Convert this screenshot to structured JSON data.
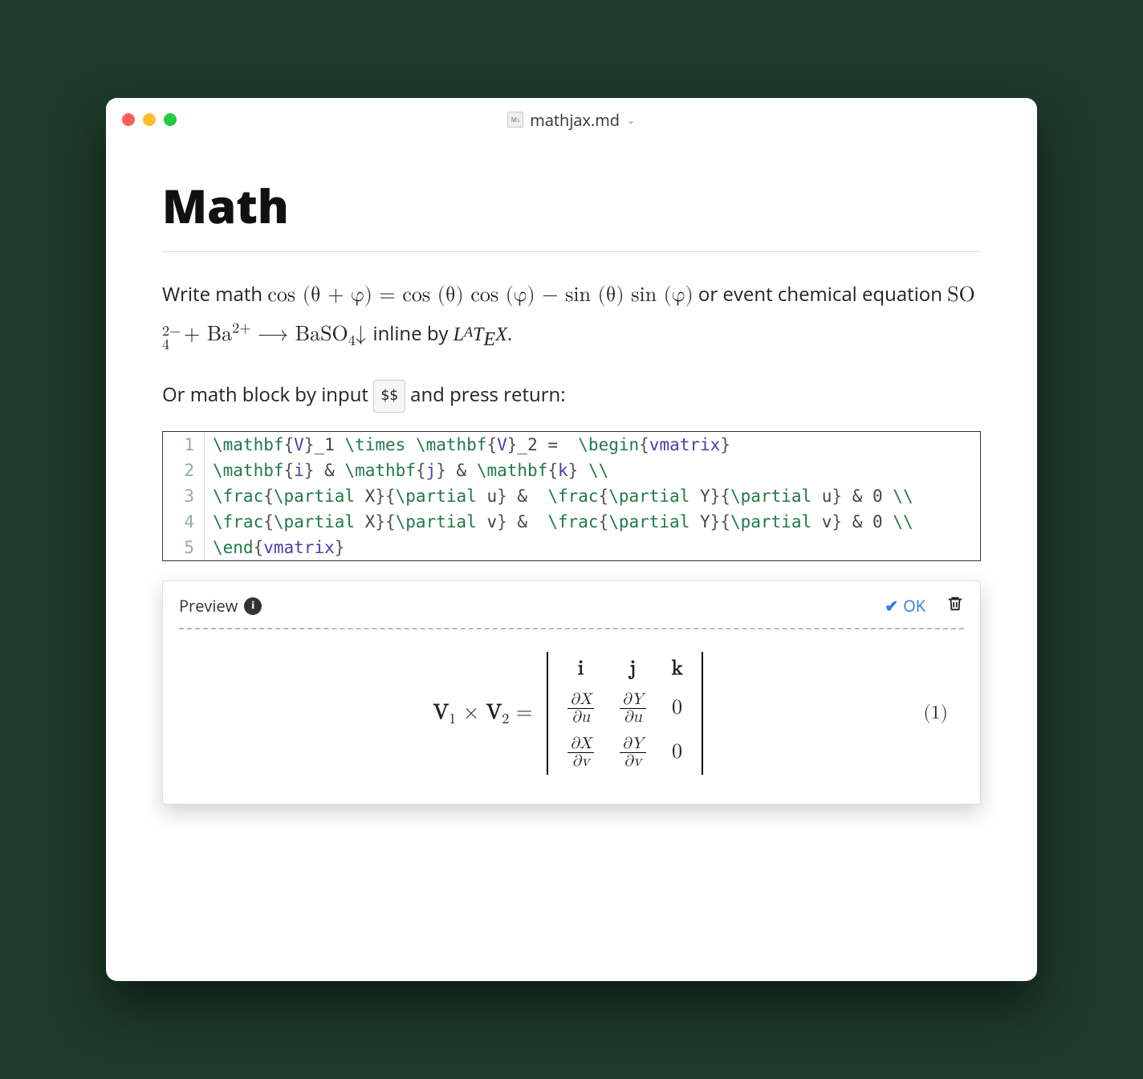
{
  "titlebar": {
    "filename": "mathjax.md"
  },
  "heading": "Math",
  "para1": {
    "pre": "Write math ",
    "inline_math": "cos (θ + φ) = cos (θ) cos (φ) − sin (θ) sin (φ)",
    "mid": "  or event chemical equation ",
    "chem_pre": "SO",
    "chem_so4_sup": "2−",
    "chem_so4_sub": "4",
    "chem_plus": " + Ba",
    "chem_ba_sup": "2+",
    "chem_arrow": " ⟶ BaSO",
    "chem_baso4_sub": "4",
    "chem_down": "↓",
    "post": "  inline by ",
    "latex_brand": "LATEX",
    "end": "."
  },
  "para2": {
    "pre": "Or math block by input ",
    "kbd": "$$",
    "post": " and press return:"
  },
  "code": {
    "line_numbers": [
      "1",
      "2",
      "3",
      "4",
      "5"
    ],
    "lines": [
      [
        {
          "t": "cmd",
          "v": "\\mathbf"
        },
        {
          "t": "brace",
          "v": "{"
        },
        {
          "t": "arg",
          "v": "V"
        },
        {
          "t": "brace",
          "v": "}"
        },
        {
          "t": "op",
          "v": "_1 "
        },
        {
          "t": "cmd",
          "v": "\\times "
        },
        {
          "t": "cmd",
          "v": "\\mathbf"
        },
        {
          "t": "brace",
          "v": "{"
        },
        {
          "t": "arg",
          "v": "V"
        },
        {
          "t": "brace",
          "v": "}"
        },
        {
          "t": "op",
          "v": "_2 =  "
        },
        {
          "t": "cmd",
          "v": "\\begin"
        },
        {
          "t": "brace",
          "v": "{"
        },
        {
          "t": "arg",
          "v": "vmatrix"
        },
        {
          "t": "brace",
          "v": "}"
        }
      ],
      [
        {
          "t": "cmd",
          "v": "\\mathbf"
        },
        {
          "t": "brace",
          "v": "{"
        },
        {
          "t": "arg",
          "v": "i"
        },
        {
          "t": "brace",
          "v": "}"
        },
        {
          "t": "op",
          "v": " & "
        },
        {
          "t": "cmd",
          "v": "\\mathbf"
        },
        {
          "t": "brace",
          "v": "{"
        },
        {
          "t": "arg",
          "v": "j"
        },
        {
          "t": "brace",
          "v": "}"
        },
        {
          "t": "op",
          "v": " & "
        },
        {
          "t": "cmd",
          "v": "\\mathbf"
        },
        {
          "t": "brace",
          "v": "{"
        },
        {
          "t": "arg",
          "v": "k"
        },
        {
          "t": "brace",
          "v": "}"
        },
        {
          "t": "op",
          "v": " "
        },
        {
          "t": "cmd",
          "v": "\\\\"
        }
      ],
      [
        {
          "t": "cmd",
          "v": "\\frac"
        },
        {
          "t": "brace",
          "v": "{"
        },
        {
          "t": "cmd",
          "v": "\\partial "
        },
        {
          "t": "op",
          "v": "X"
        },
        {
          "t": "brace",
          "v": "}"
        },
        {
          "t": "brace",
          "v": "{"
        },
        {
          "t": "cmd",
          "v": "\\partial "
        },
        {
          "t": "op",
          "v": "u"
        },
        {
          "t": "brace",
          "v": "}"
        },
        {
          "t": "op",
          "v": " &  "
        },
        {
          "t": "cmd",
          "v": "\\frac"
        },
        {
          "t": "brace",
          "v": "{"
        },
        {
          "t": "cmd",
          "v": "\\partial "
        },
        {
          "t": "op",
          "v": "Y"
        },
        {
          "t": "brace",
          "v": "}"
        },
        {
          "t": "brace",
          "v": "{"
        },
        {
          "t": "cmd",
          "v": "\\partial "
        },
        {
          "t": "op",
          "v": "u"
        },
        {
          "t": "brace",
          "v": "}"
        },
        {
          "t": "op",
          "v": " & 0 "
        },
        {
          "t": "cmd",
          "v": "\\\\"
        }
      ],
      [
        {
          "t": "cmd",
          "v": "\\frac"
        },
        {
          "t": "brace",
          "v": "{"
        },
        {
          "t": "cmd",
          "v": "\\partial "
        },
        {
          "t": "op",
          "v": "X"
        },
        {
          "t": "brace",
          "v": "}"
        },
        {
          "t": "brace",
          "v": "{"
        },
        {
          "t": "cmd",
          "v": "\\partial "
        },
        {
          "t": "op",
          "v": "v"
        },
        {
          "t": "brace",
          "v": "}"
        },
        {
          "t": "op",
          "v": " &  "
        },
        {
          "t": "cmd",
          "v": "\\frac"
        },
        {
          "t": "brace",
          "v": "{"
        },
        {
          "t": "cmd",
          "v": "\\partial "
        },
        {
          "t": "op",
          "v": "Y"
        },
        {
          "t": "brace",
          "v": "}"
        },
        {
          "t": "brace",
          "v": "{"
        },
        {
          "t": "cmd",
          "v": "\\partial "
        },
        {
          "t": "op",
          "v": "v"
        },
        {
          "t": "brace",
          "v": "}"
        },
        {
          "t": "op",
          "v": " & 0 "
        },
        {
          "t": "cmd",
          "v": "\\\\"
        }
      ],
      [
        {
          "t": "cmd",
          "v": "\\end"
        },
        {
          "t": "brace",
          "v": "{"
        },
        {
          "t": "arg",
          "v": "vmatrix"
        },
        {
          "t": "brace",
          "v": "}"
        }
      ]
    ]
  },
  "preview": {
    "label": "Preview",
    "ok_label": "OK",
    "equation_number": "(1)",
    "lhs_v": "V",
    "lhs_sub1": "1",
    "lhs_times": " × ",
    "lhs_sub2": "2",
    "lhs_eq": " = ",
    "matrix": {
      "row1": {
        "c1": "i",
        "c2": "j",
        "c3": "k"
      },
      "row2": {
        "c1_num": "∂X",
        "c1_den": "∂u",
        "c2_num": "∂Y",
        "c2_den": "∂u",
        "c3": "0"
      },
      "row3": {
        "c1_num": "∂X",
        "c1_den": "∂v",
        "c2_num": "∂Y",
        "c2_den": "∂v",
        "c3": "0"
      }
    }
  }
}
